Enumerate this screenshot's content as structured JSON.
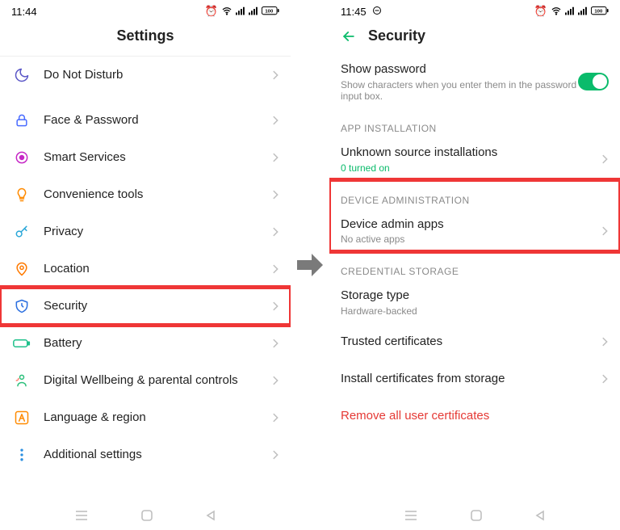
{
  "left": {
    "time": "11:44",
    "title": "Settings",
    "items": [
      {
        "label": "Do Not Disturb",
        "icon": "moon",
        "color": "#5b57c7"
      },
      {
        "label": "Face & Password",
        "icon": "lock",
        "color": "#4a6cff"
      },
      {
        "label": "Smart Services",
        "icon": "circle-dot",
        "color": "#c526c5"
      },
      {
        "label": "Convenience tools",
        "icon": "bulb",
        "color": "#ff8a00"
      },
      {
        "label": "Privacy",
        "icon": "key",
        "color": "#2aa7d8"
      },
      {
        "label": "Location",
        "icon": "pin",
        "color": "#ff7a00"
      },
      {
        "label": "Security",
        "icon": "shield",
        "color": "#2b6fe0",
        "highlight": true
      },
      {
        "label": "Battery",
        "icon": "battery",
        "color": "#1fc08b"
      },
      {
        "label": "Digital Wellbeing & parental controls",
        "icon": "wellbeing",
        "color": "#2bbf7a"
      },
      {
        "label": "Language & region",
        "icon": "letter-a",
        "color": "#ff8a00"
      },
      {
        "label": "Additional settings",
        "icon": "more",
        "color": "#2b8fe0"
      }
    ]
  },
  "right": {
    "time": "11:45",
    "title": "Security",
    "show_password": {
      "label": "Show password",
      "sub": "Show characters when you enter them in the password input box.",
      "on": true
    },
    "sections": [
      {
        "head": "APP INSTALLATION",
        "items": [
          {
            "label": "Unknown source installations",
            "sub": "0 turned on",
            "sub_green": true,
            "chev": true
          }
        ]
      },
      {
        "head": "DEVICE ADMINISTRATION",
        "highlight": true,
        "items": [
          {
            "label": "Device admin apps",
            "sub": "No active apps",
            "chev": true
          }
        ]
      },
      {
        "head": "CREDENTIAL STORAGE",
        "items": [
          {
            "label": "Storage type",
            "sub": "Hardware-backed",
            "chev": false
          },
          {
            "label": "Trusted certificates",
            "chev": true
          },
          {
            "label": "Install certificates from storage",
            "chev": true
          },
          {
            "label": "Remove all user certificates",
            "danger": true,
            "chev": false
          }
        ]
      }
    ]
  }
}
